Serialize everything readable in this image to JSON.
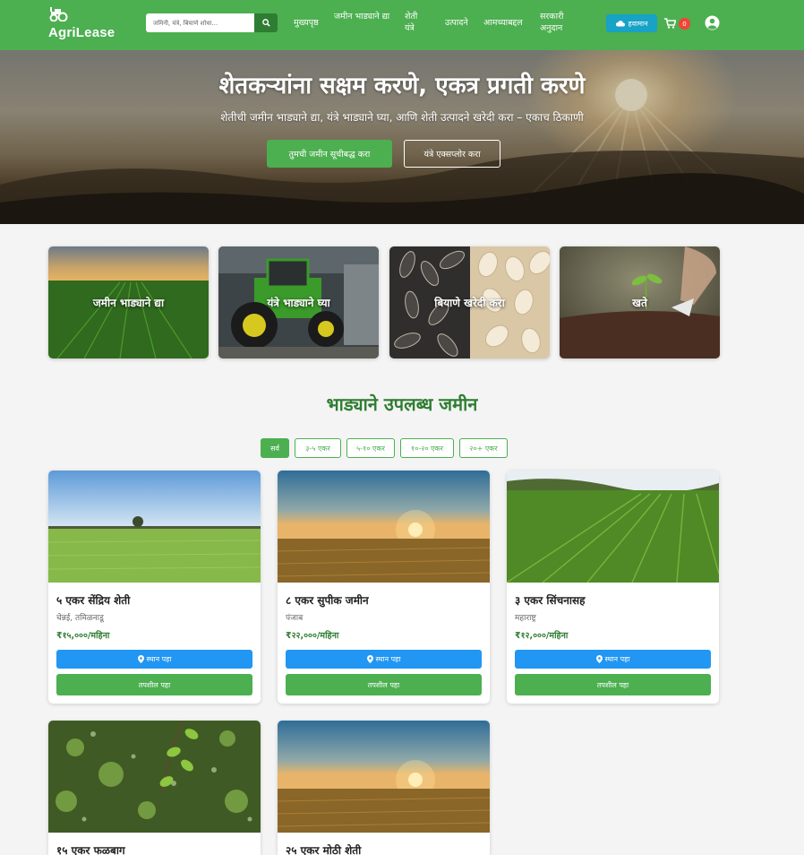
{
  "nav": {
    "brand": "AgriLease",
    "search_placeholder": "जमिनी, यंत्रे, बियाणे शोधा...",
    "links": [
      {
        "label": "मुख्यपृष्ठ"
      },
      {
        "label": "जमीन भाड्याने द्या"
      },
      {
        "label": "शेती यंत्रे"
      },
      {
        "label": "उत्पादने"
      },
      {
        "label": "आमच्याबद्दल"
      },
      {
        "label": "सरकारी अनुदान"
      }
    ],
    "weather_label": "हवामान",
    "cart_count": "0"
  },
  "hero": {
    "title": "शेतकऱ्यांना सक्षम करणे, एकत्र प्रगती करणे",
    "subtitle": "शेतीची जमीन भाड्याने द्या, यंत्रे भाड्याने घ्या, आणि शेती उत्पादने खरेदी करा – एकाच ठिकाणी",
    "primary_button": "तुमची जमीन सूचीबद्ध करा",
    "secondary_button": "यंत्रे एक्सप्लोर करा"
  },
  "categories": [
    {
      "label": "जमीन भाड्याने द्या"
    },
    {
      "label": "यंत्रे भाड्याने घ्या"
    },
    {
      "label": "बियाणे खरेदी करा"
    },
    {
      "label": "खते"
    }
  ],
  "section": {
    "title": "भाड्याने उपलब्ध जमीन",
    "filters": [
      {
        "label": "सर्व",
        "active": true
      },
      {
        "label": "३-५ एकर",
        "active": false
      },
      {
        "label": "५-१० एकर",
        "active": false
      },
      {
        "label": "१०-२० एकर",
        "active": false
      },
      {
        "label": "२०+ एकर",
        "active": false
      }
    ]
  },
  "listings": [
    {
      "title": "५ एकर सेंद्रिय शेती",
      "location": "चेन्नई, तमिळनाडू",
      "price": "₹१५,०००/महिना",
      "location_button": "स्थान पहा",
      "details_button": "तपशील पहा"
    },
    {
      "title": "८ एकर सुपीक जमीन",
      "location": "पंजाब",
      "price": "₹२२,०००/महिना",
      "location_button": "स्थान पहा",
      "details_button": "तपशील पहा"
    },
    {
      "title": "३ एकर सिंचनासह",
      "location": "महाराष्ट्र",
      "price": "₹१२,०००/महिना",
      "location_button": "स्थान पहा",
      "details_button": "तपशील पहा"
    },
    {
      "title": "१५ एकर फळबाग"
    },
    {
      "title": "२५ एकर मोठी शेती"
    }
  ],
  "colors": {
    "primary_green": "#4caf50",
    "dark_green": "#2e7d32",
    "blue": "#2196f3",
    "weather": "#17a2c6",
    "badge": "#f44336"
  },
  "icons": [
    "tractor-icon",
    "search-icon",
    "cloud-icon",
    "cart-icon",
    "user-circle-icon",
    "map-marker-icon"
  ]
}
